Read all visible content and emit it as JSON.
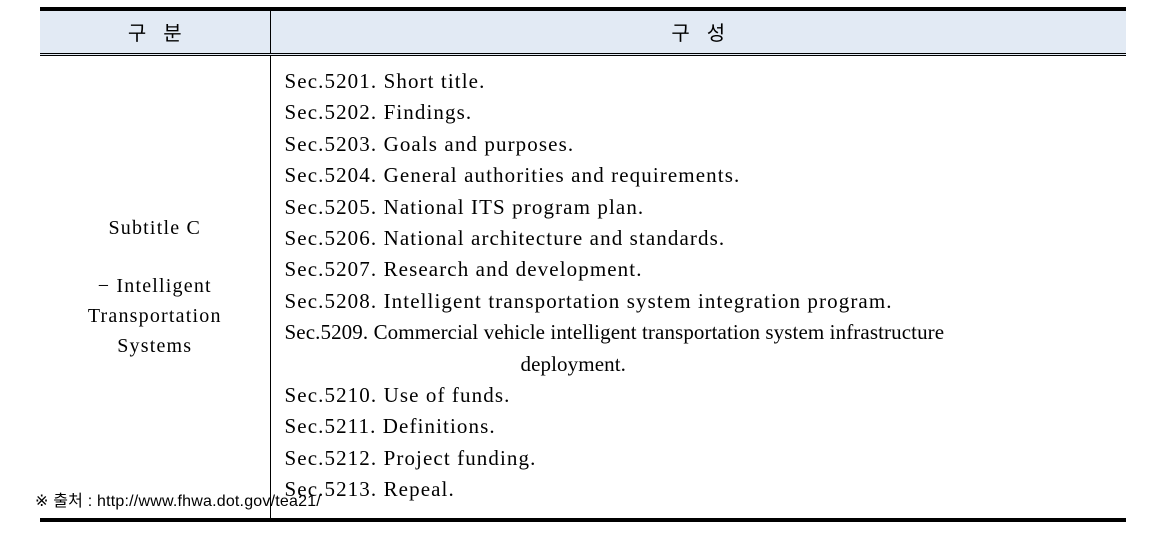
{
  "table": {
    "headers": {
      "division": "구 분",
      "composition": "구 성"
    },
    "row": {
      "division_title": "Subtitle C",
      "division_subtitle": "− Intelligent Transportation Systems",
      "sections": [
        "Sec.5201. Short title.",
        "Sec.5202. Findings.",
        "Sec.5203. Goals and purposes.",
        "Sec.5204. General authorities and requirements.",
        "Sec.5205. National ITS program plan.",
        "Sec.5206. National architecture and standards.",
        "Sec.5207. Research and development.",
        "Sec.5208. Intelligent transportation system integration program.",
        "Sec.5209. Commercial vehicle intelligent transportation system infrastructure",
        "Sec.5210. Use of funds.",
        "Sec.5211. Definitions.",
        "Sec.5212. Project funding.",
        "Sec.5213. Repeal."
      ],
      "section_5209_continuation": "deployment."
    }
  },
  "footnote": {
    "text": "※ 출처 : http://www.fhwa.dot.gov/tea21/"
  },
  "colors": {
    "header_fill": "#e2eaf4",
    "rule": "#000000",
    "text": "#000000"
  }
}
